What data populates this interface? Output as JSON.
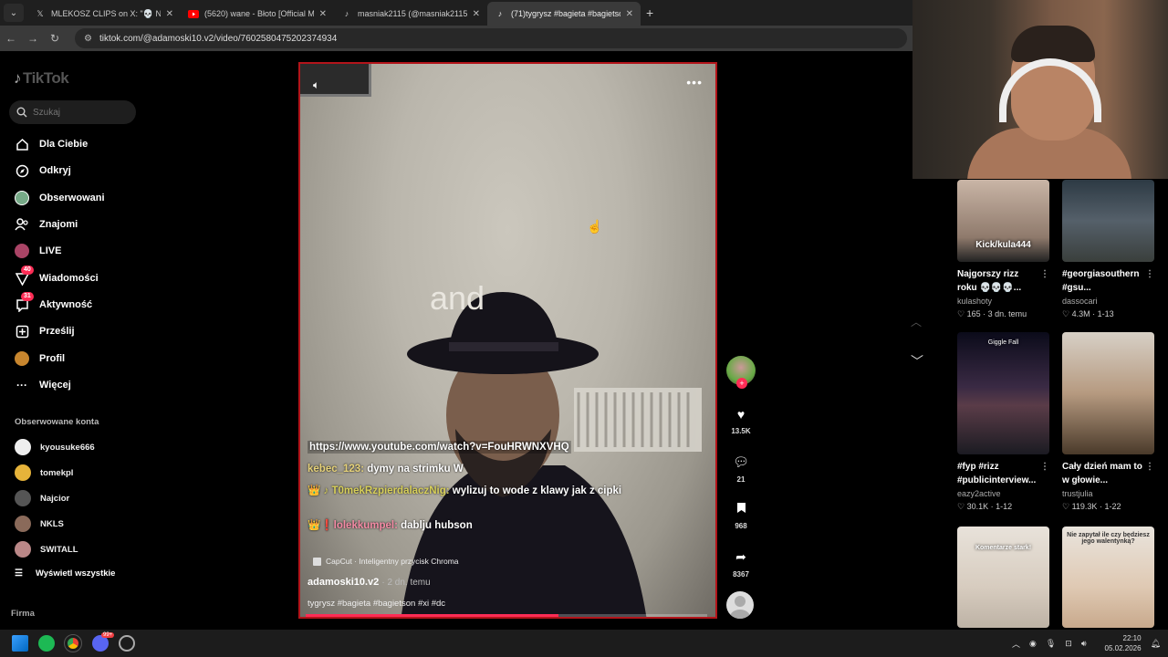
{
  "browser": {
    "tabs": [
      {
        "icon": "x-icon",
        "title": "MLEKOSZ CLIPS on X: \"💀 NIE...",
        "active": false
      },
      {
        "icon": "youtube-icon",
        "title": "(5620) wane - Błoto [Official M...",
        "active": false
      },
      {
        "icon": "tiktok-icon",
        "title": "masniak2115 (@masniak2115) ...",
        "active": false
      },
      {
        "icon": "tiktok-icon",
        "title": "(71)tygrysz #bagieta #bagietso...",
        "active": true
      }
    ],
    "url": "tiktok.com/@adamoski10.v2/video/7602580475202374934"
  },
  "sidebar": {
    "logo": "TikTok",
    "search_placeholder": "Szukaj",
    "nav": [
      {
        "label": "Dla Ciebie",
        "icon": "home-icon"
      },
      {
        "label": "Odkryj",
        "icon": "compass-icon"
      },
      {
        "label": "Obserwowani",
        "icon": "following-avatar-icon"
      },
      {
        "label": "Znajomi",
        "icon": "friends-icon"
      },
      {
        "label": "LIVE",
        "icon": "live-icon"
      },
      {
        "label": "Wiadomości",
        "icon": "messages-icon",
        "badge": "40"
      },
      {
        "label": "Aktywność",
        "icon": "activity-icon",
        "badge": "31"
      },
      {
        "label": "Prześlij",
        "icon": "upload-icon"
      },
      {
        "label": "Profil",
        "icon": "profile-icon"
      },
      {
        "label": "Więcej",
        "icon": "more-icon"
      }
    ],
    "followed_label": "Obserwowane konta",
    "accounts": [
      "kyousuke666",
      "tomekpl",
      "Najcior",
      "NKLS",
      "SWITALL"
    ],
    "see_all": "Wyświetl wszystkie",
    "footer": "Firma"
  },
  "video": {
    "overlay_word": "and",
    "chat": [
      {
        "user": "",
        "text": "https://www.youtube.com/watch?v=FouHRWNXVHQ"
      },
      {
        "user": "kebec_123:",
        "text": "dymy na strimku W"
      },
      {
        "user": "👑 ♪ T0mekRzpierdalaczNig:",
        "text": "wylizuj to wode z klawy jak z cipki"
      },
      {
        "user": "👑❗lolekkumpel:",
        "text": "dablju hubson"
      }
    ],
    "capcut": "CapCut · Inteligentny przycisk Chroma",
    "author": "adamoski10.v2",
    "time": "· 2 dn. temu",
    "caption": "tygrysz #bagieta #bagietson #xi #dc",
    "progress": 0.63
  },
  "actions": {
    "likes": "13.5K",
    "comments": "21",
    "saves": "968",
    "shares": "8367"
  },
  "grid": [
    {
      "overlay": "Kick/kula444",
      "title": "Najgorszy rizz roku 💀💀💀...",
      "author": "kulashoty",
      "likes": "165",
      "date": "3 dn. temu"
    },
    {
      "overlay": "",
      "title": "#georgiasouthern #gsu...",
      "author": "dassocari",
      "likes": "4.3M",
      "date": "1-13"
    },
    {
      "overlay": "Giggle Fall",
      "title": "#fyp #rizz #publicinterview...",
      "author": "eazy2active",
      "likes": "30.1K",
      "date": "1-12"
    },
    {
      "overlay": "",
      "title": "Cały dzień mam to w głowie...",
      "author": "trustjulia",
      "likes": "119.3K",
      "date": "1-22"
    },
    {
      "overlay": "Komentarze stark!",
      "title": "",
      "author": "",
      "likes": "",
      "date": ""
    },
    {
      "overlay": "Nie zapytał ile czy będziesz jego walentynką?",
      "title": "",
      "author": "",
      "likes": "",
      "date": ""
    }
  ],
  "taskbar": {
    "time": "22:10",
    "date": "05.02.2026",
    "discord_badge": "99+"
  }
}
